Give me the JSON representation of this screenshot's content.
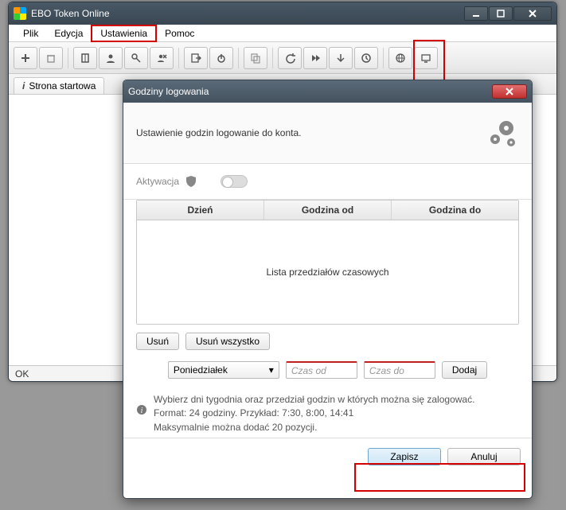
{
  "window": {
    "title": "EBO Token Online"
  },
  "menu": {
    "items": [
      "Plik",
      "Edycja",
      "Ustawienia",
      "Pomoc"
    ]
  },
  "toolbar_icons": [
    "plus-icon",
    "trash-icon",
    "book-icon",
    "user-icon",
    "key-icon",
    "user-remove-icon",
    "export-icon",
    "power-icon",
    "copy-icon",
    "undo-icon",
    "forward-icon",
    "down-icon",
    "clock-icon",
    "globe-icon",
    "monitor-icon"
  ],
  "tab": {
    "label": "Strona startowa"
  },
  "status": {
    "text": "OK"
  },
  "dialog": {
    "title": "Godziny logowania",
    "heading": "Ustawienie godzin logowanie do konta.",
    "activation_label": "Aktywacja",
    "columns": [
      "Dzień",
      "Godzina od",
      "Godzina do"
    ],
    "empty_text": "Lista przedziałów czasowych",
    "btn_delete": "Usuń",
    "btn_delete_all": "Usuń wszystko",
    "day_select": "Poniedziałek",
    "from_placeholder": "Czas od",
    "to_placeholder": "Czas do",
    "btn_add": "Dodaj",
    "hint_line1": "Wybierz dni tygodnia oraz przedział godzin w których można się zalogować.",
    "hint_line2": "Format: 24 godziny. Przykład: 7:30, 8:00, 14:41",
    "hint_line3": "Maksymalnie można dodać 20 pozycji.",
    "btn_save": "Zapisz",
    "btn_cancel": "Anuluj"
  }
}
